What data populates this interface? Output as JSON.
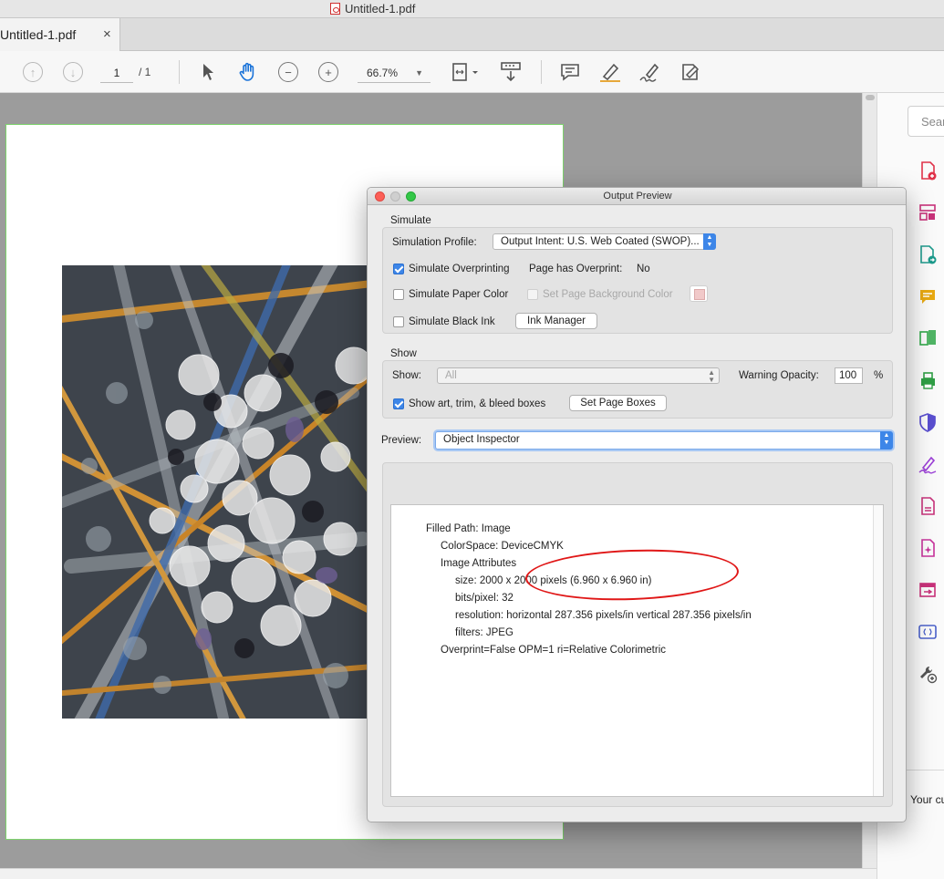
{
  "window": {
    "title": "Untitled-1.pdf"
  },
  "tab": {
    "name": "Untitled-1.pdf",
    "close": "×"
  },
  "toolbar": {
    "page_current": "1",
    "page_total": "/ 1",
    "zoom": "66.7%"
  },
  "tools_pane": {
    "search_placeholder": "Sear",
    "footer_text": "Your cu",
    "icon_colors": [
      "#e0334a",
      "#c8327a",
      "#1d9a8c",
      "#e8a912",
      "#31a84a",
      "#2f9e45",
      "#5a4fcf",
      "#9b3fd6",
      "#c7327a",
      "#c7329b",
      "#c8327a",
      "#4b61c9",
      "#555555"
    ]
  },
  "dialog": {
    "title": "Output Preview",
    "simulate": {
      "section_label": "Simulate",
      "profile_label": "Simulation Profile:",
      "profile_value": "Output Intent: U.S. Web Coated (SWOP)...",
      "overprinting_label": "Simulate Overprinting",
      "overprinting_checked": true,
      "page_overprint_label": "Page has Overprint:",
      "page_overprint_value": "No",
      "paper_color_label": "Simulate Paper Color",
      "paper_color_checked": false,
      "page_bg_label": "Set Page Background Color",
      "black_ink_label": "Simulate Black Ink",
      "black_ink_checked": false,
      "ink_manager_label": "Ink Manager"
    },
    "show": {
      "section_label": "Show",
      "show_label": "Show:",
      "show_value": "All",
      "warning_label": "Warning Opacity:",
      "warning_value": "100",
      "warning_unit": "%",
      "boxes_label": "Show art, trim, & bleed boxes",
      "boxes_checked": true,
      "set_page_boxes_label": "Set Page Boxes"
    },
    "preview": {
      "label": "Preview:",
      "value": "Object Inspector"
    },
    "inspector": {
      "lines": [
        "Filled Path: Image",
        "ColorSpace: DeviceCMYK",
        "Image Attributes",
        "size: 2000 x 2000 pixels (6.960 x 6.960 in)",
        "bits/pixel: 32",
        "resolution: horizontal 287.356 pixels/in vertical 287.356 pixels/in",
        "filters: JPEG",
        "Overprint=False OPM=1 ri=Relative Colorimetric"
      ]
    }
  },
  "colors": {
    "accent": "#3d86e8",
    "page_border": "#7ed36d",
    "annotation": "#e01717"
  }
}
